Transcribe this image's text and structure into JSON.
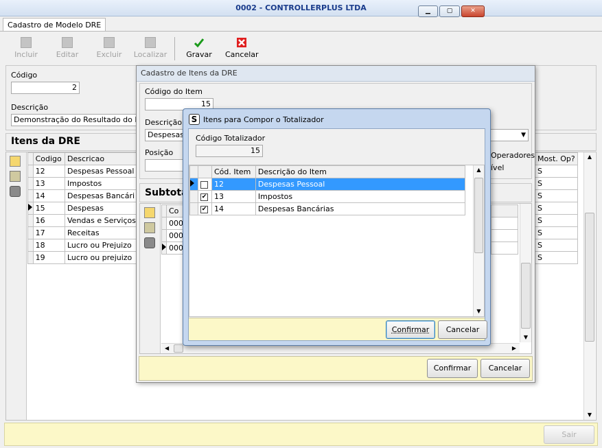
{
  "window": {
    "title": "0002 - CONTROLLERPLUS LTDA"
  },
  "tab": {
    "label": "Cadastro de Modelo DRE"
  },
  "toolbar": {
    "incluir": "Incluir",
    "editar": "Editar",
    "excluir": "Excluir",
    "localizar": "Localizar",
    "gravar": "Gravar",
    "cancelar": "Cancelar"
  },
  "form": {
    "codigo_label": "Código",
    "codigo_value": "2",
    "descricao_label": "Descrição",
    "descricao_value": "Demonstração do Resultado do Exerc"
  },
  "itens": {
    "title": "Itens da DRE",
    "headers": {
      "codigo": "Codigo",
      "descricao": "Descricao",
      "mostop": "Most. Op?"
    },
    "rows": [
      {
        "codigo": "12",
        "descricao": "Despesas Pessoal",
        "mostop": "S"
      },
      {
        "codigo": "13",
        "descricao": "Impostos",
        "mostop": "S"
      },
      {
        "codigo": "14",
        "descricao": "Despesas Bancári",
        "mostop": "S"
      },
      {
        "codigo": "15",
        "descricao": "Despesas",
        "mostop": "S"
      },
      {
        "codigo": "16",
        "descricao": "Vendas e Serviços",
        "mostop": "S"
      },
      {
        "codigo": "17",
        "descricao": "Receitas",
        "mostop": "S"
      },
      {
        "codigo": "18",
        "descricao": "Lucro ou Prejuizo",
        "mostop": "S"
      },
      {
        "codigo": "19",
        "descricao": "Lucro ou prejuizo",
        "mostop": "S"
      }
    ]
  },
  "footer": {
    "sair": "Sair"
  },
  "dialog1": {
    "title": "Cadastro de Itens da DRE",
    "codigo_item_label": "Código do Item",
    "codigo_item_value": "15",
    "descricao_label": "Descrição d",
    "descricao_value": "Despesas",
    "posicao_label": "Posição",
    "operadores": "Operadores",
    "visivel": "ível",
    "subtotal_title": "Subtota",
    "sub_header": "Co",
    "sub_rows": [
      "000",
      "000",
      "000"
    ],
    "confirmar": "Confirmar",
    "cancelar": "Cancelar"
  },
  "dialog2": {
    "title": "Itens para Compor o Totalizador",
    "codigo_totalizador_label": "Código Totalizador",
    "codigo_totalizador_value": "15",
    "headers": {
      "cod": "Cód. Item",
      "desc": "Descrição do Item"
    },
    "rows": [
      {
        "cod": "12",
        "desc": "Despesas Pessoal",
        "checked": true,
        "selected": true
      },
      {
        "cod": "13",
        "desc": "Impostos",
        "checked": true,
        "selected": false
      },
      {
        "cod": "14",
        "desc": "Despesas Bancárias",
        "checked": true,
        "selected": false
      }
    ],
    "confirmar": "Confirmar",
    "cancelar": "Cancelar"
  }
}
